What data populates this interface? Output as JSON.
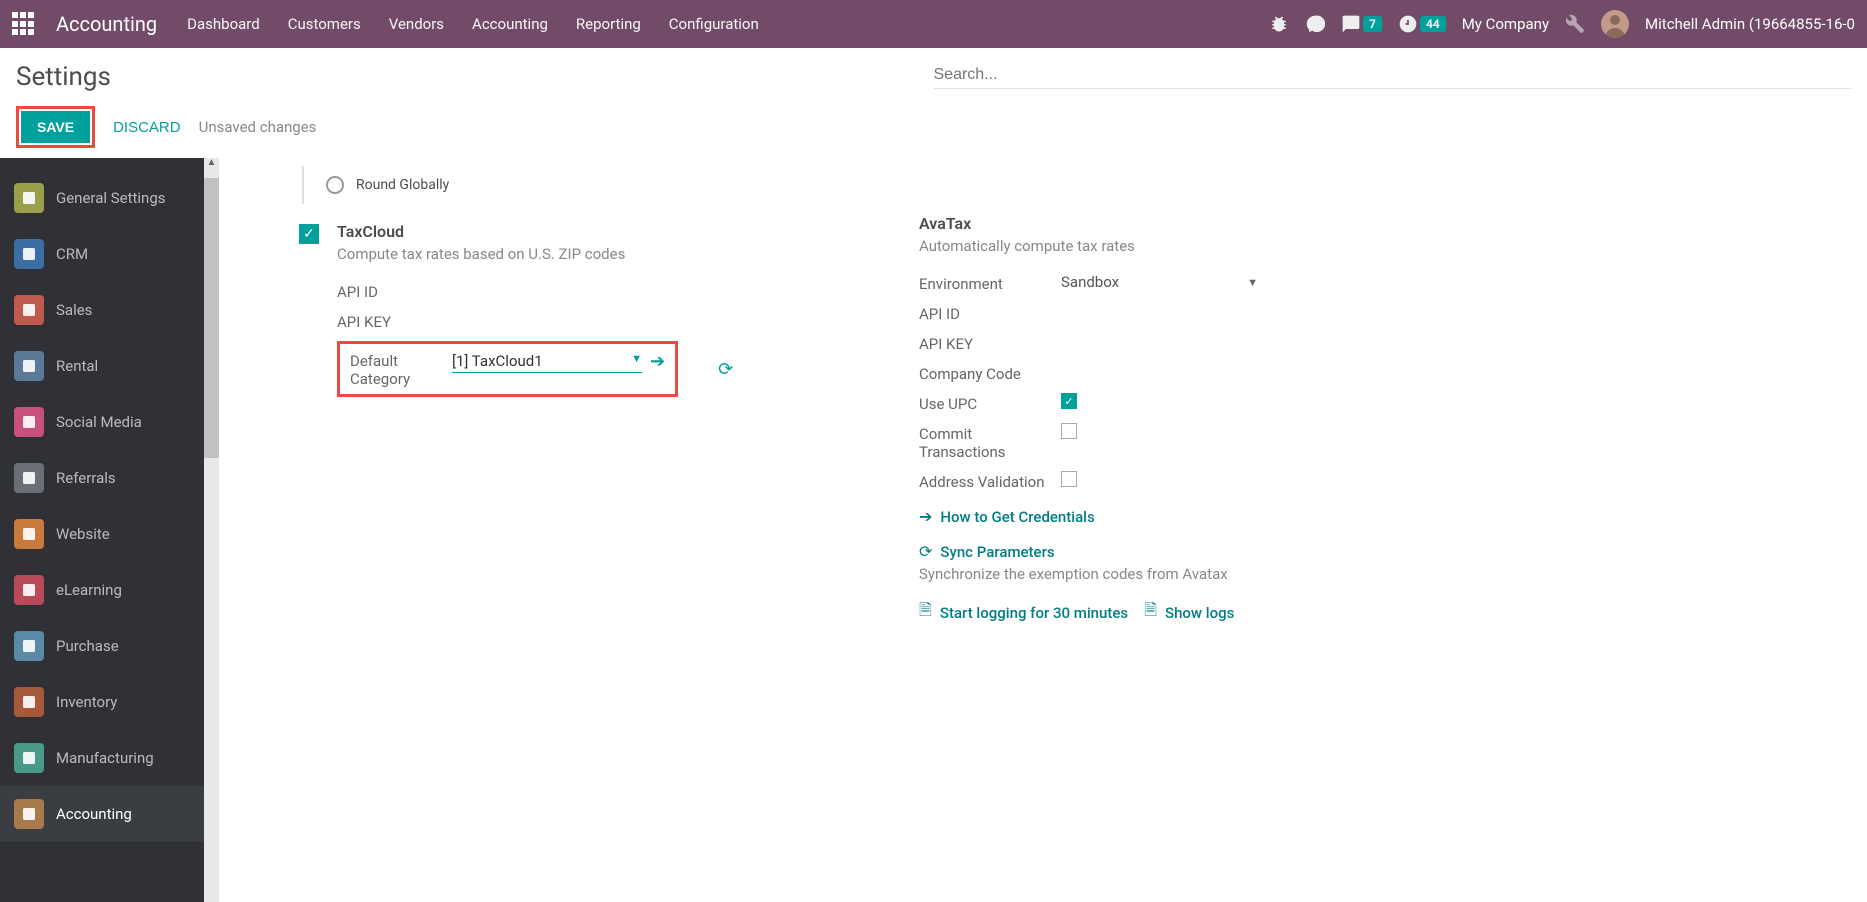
{
  "nav": {
    "app": "Accounting",
    "menu": [
      "Dashboard",
      "Customers",
      "Vendors",
      "Accounting",
      "Reporting",
      "Configuration"
    ],
    "msg_count": "7",
    "activity_count": "44",
    "company": "My Company",
    "user": "Mitchell Admin (19664855-16-0"
  },
  "page": {
    "title": "Settings",
    "search_placeholder": "Search...",
    "save": "SAVE",
    "discard": "DISCARD",
    "unsaved": "Unsaved changes"
  },
  "sidebar": [
    {
      "label": "General Settings",
      "color": "#9aa04a"
    },
    {
      "label": "CRM",
      "color": "#3a6ea5"
    },
    {
      "label": "Sales",
      "color": "#c15a4e"
    },
    {
      "label": "Rental",
      "color": "#5a7a9a"
    },
    {
      "label": "Social Media",
      "color": "#c94f7c"
    },
    {
      "label": "Referrals",
      "color": "#6a7075"
    },
    {
      "label": "Website",
      "color": "#c97a3a"
    },
    {
      "label": "eLearning",
      "color": "#b94a5a"
    },
    {
      "label": "Purchase",
      "color": "#5a8aa5"
    },
    {
      "label": "Inventory",
      "color": "#a65a3a"
    },
    {
      "label": "Manufacturing",
      "color": "#4a9a8a"
    },
    {
      "label": "Accounting",
      "color": "#a67a4a",
      "active": true
    }
  ],
  "rounding": {
    "label": "Round Globally"
  },
  "taxcloud": {
    "title": "TaxCloud",
    "desc": "Compute tax rates based on U.S. ZIP codes",
    "api_id": "API ID",
    "api_key": "API KEY",
    "default_cat_label": "Default Category",
    "default_cat_value": "[1] TaxCloud1"
  },
  "avatax": {
    "title": "AvaTax",
    "desc": "Automatically compute tax rates",
    "env_label": "Environment",
    "env_value": "Sandbox",
    "api_id": "API ID",
    "api_key": "API KEY",
    "company_code": "Company Code",
    "use_upc": "Use UPC",
    "commit": "Commit Transactions",
    "addr": "Address Validation",
    "how_to": "How to Get Credentials",
    "sync_title": "Sync Parameters",
    "sync_desc": "Synchronize the exemption codes from Avatax",
    "start_log": "Start logging for 30 minutes",
    "show_logs": "Show logs"
  }
}
